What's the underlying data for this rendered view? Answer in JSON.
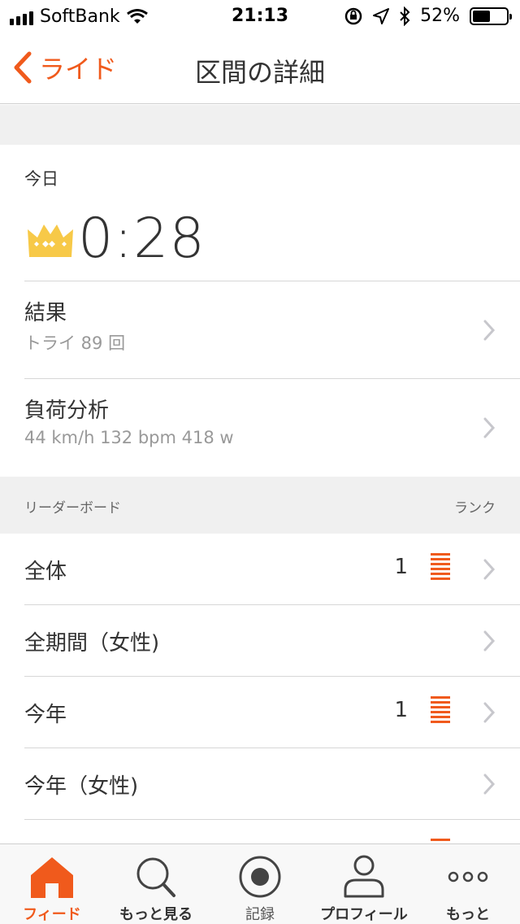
{
  "status_bar": {
    "carrier": "SoftBank",
    "time": "21:13",
    "battery_percent": "52%",
    "battery_level": 0.52
  },
  "nav": {
    "back_label": "ライド",
    "title": "区間の詳細"
  },
  "summary": {
    "date_label": "今日",
    "time": "0:28"
  },
  "details": [
    {
      "title": "結果",
      "subtitle": "トライ 89 回"
    },
    {
      "title": "負荷分析",
      "subtitle": "44 km/h 132 bpm 418 w"
    }
  ],
  "leaderboard": {
    "header": "リーダーボード",
    "rank_header": "ランク",
    "rows": [
      {
        "label": "全体",
        "rank": "1"
      },
      {
        "label": "全期間（女性)",
        "rank": ""
      },
      {
        "label": "今年",
        "rank": "1"
      },
      {
        "label": "今年（女性)",
        "rank": ""
      }
    ]
  },
  "tabs": [
    {
      "label": "フィード",
      "icon": "home-icon",
      "active": true
    },
    {
      "label": "もっと見る",
      "icon": "search-icon",
      "active": false
    },
    {
      "label": "記録",
      "icon": "record-icon",
      "active": false
    },
    {
      "label": "プロフィール",
      "icon": "profile-icon",
      "active": false
    },
    {
      "label": "もっと",
      "icon": "more-icon",
      "active": false
    }
  ],
  "colors": {
    "accent": "#f05a1c",
    "crown": "#f7c948",
    "band": "#f0f0f0"
  }
}
